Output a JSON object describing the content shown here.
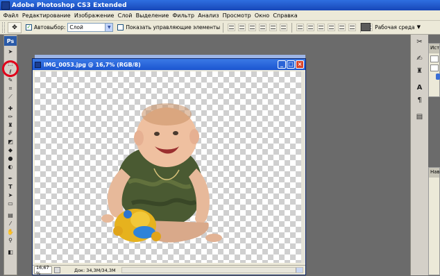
{
  "app": {
    "title": "Adobe Photoshop CS3 Extended",
    "icon": "ps-app-icon"
  },
  "menu": [
    "Файл",
    "Редактирование",
    "Изображение",
    "Слой",
    "Выделение",
    "Фильтр",
    "Анализ",
    "Просмотр",
    "Окно",
    "Справка"
  ],
  "options": {
    "autoselect_label": "Автовыбор:",
    "autoselect_value": "Слой",
    "show_controls_label": "Показать управляющие элементы",
    "workspace_label": "Рабочая среда"
  },
  "toolbox": {
    "logo": "Ps",
    "tools": [
      "move-tool",
      "marquee-tool",
      "lasso-tool",
      "quick-selection-tool",
      "crop-tool",
      "slice-tool",
      "healing-brush-tool",
      "brush-tool",
      "clone-stamp-tool",
      "history-brush-tool",
      "eraser-tool",
      "paint-bucket-tool",
      "blur-tool",
      "dodge-tool",
      "pen-tool",
      "type-tool",
      "path-selection-tool",
      "rectangle-tool",
      "notes-tool",
      "eyedropper-tool",
      "hand-tool",
      "zoom-tool",
      "color-swatches"
    ],
    "highlighted_tool": "lasso-tool"
  },
  "document": {
    "background_title": "IMG_0053.jpg @ 16,7% (RGB/8)",
    "title": "IMG_0053.jpg @ 16,7% (RGB/8)",
    "zoom": "16,67 %",
    "docinfo": "Док: 34,3M/34,3M"
  },
  "panels": {
    "history_tab": "Исто",
    "navigator_tab": "Нави"
  },
  "colors": {
    "annotation": "#e0001a",
    "titlebar": "#1c56d0"
  }
}
